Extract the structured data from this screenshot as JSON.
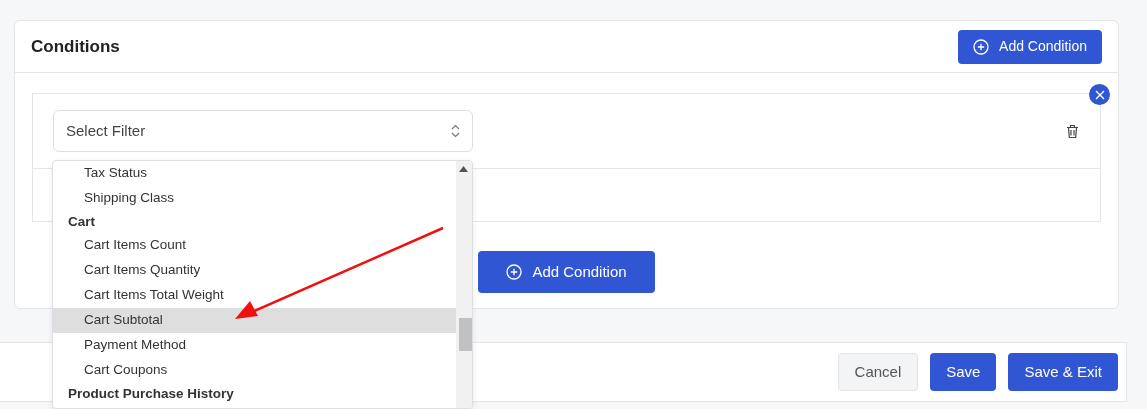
{
  "panel": {
    "title": "Conditions",
    "add_button": "Add Condition"
  },
  "condition": {
    "filter_placeholder": "Select Filter"
  },
  "add_condition_button": "Add Condition",
  "dropdown": {
    "entries": [
      {
        "kind": "option",
        "label": "Tax Status",
        "selected": false
      },
      {
        "kind": "option",
        "label": "Shipping Class",
        "selected": false
      },
      {
        "kind": "group",
        "label": "Cart"
      },
      {
        "kind": "option",
        "label": "Cart Items Count",
        "selected": false
      },
      {
        "kind": "option",
        "label": "Cart Items Quantity",
        "selected": false
      },
      {
        "kind": "option",
        "label": "Cart Items Total Weight",
        "selected": false
      },
      {
        "kind": "option",
        "label": "Cart Subtotal",
        "selected": true
      },
      {
        "kind": "option",
        "label": "Payment Method",
        "selected": false
      },
      {
        "kind": "option",
        "label": "Cart Coupons",
        "selected": false
      },
      {
        "kind": "group",
        "label": "Product Purchase History"
      }
    ]
  },
  "footer": {
    "buttons": [
      {
        "label": "Cancel",
        "kind": "secondary"
      },
      {
        "label": "Save",
        "kind": "primary"
      },
      {
        "label": "Save & Exit",
        "kind": "primary"
      }
    ]
  }
}
